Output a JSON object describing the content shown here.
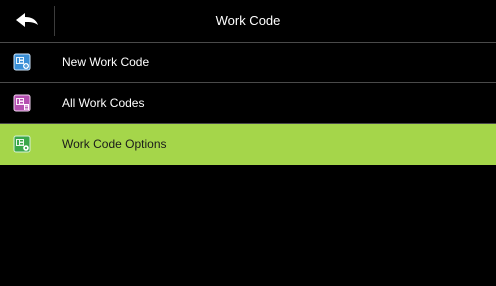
{
  "header": {
    "title": "Work Code",
    "back_icon": "back-arrow-icon"
  },
  "menu": {
    "items": [
      {
        "label": "New Work Code",
        "icon": "new-work-code-icon",
        "icon_color": "#3a8fd6",
        "selected": false
      },
      {
        "label": "All Work Codes",
        "icon": "all-work-codes-icon",
        "icon_color": "#b44fb0",
        "selected": false
      },
      {
        "label": "Work Code Options",
        "icon": "work-code-options-icon",
        "icon_color": "#3aa84a",
        "selected": true
      }
    ]
  },
  "colors": {
    "background": "#000000",
    "selected_row": "#a5d64a",
    "divider": "#4a4a4a",
    "text": "#ffffff"
  }
}
